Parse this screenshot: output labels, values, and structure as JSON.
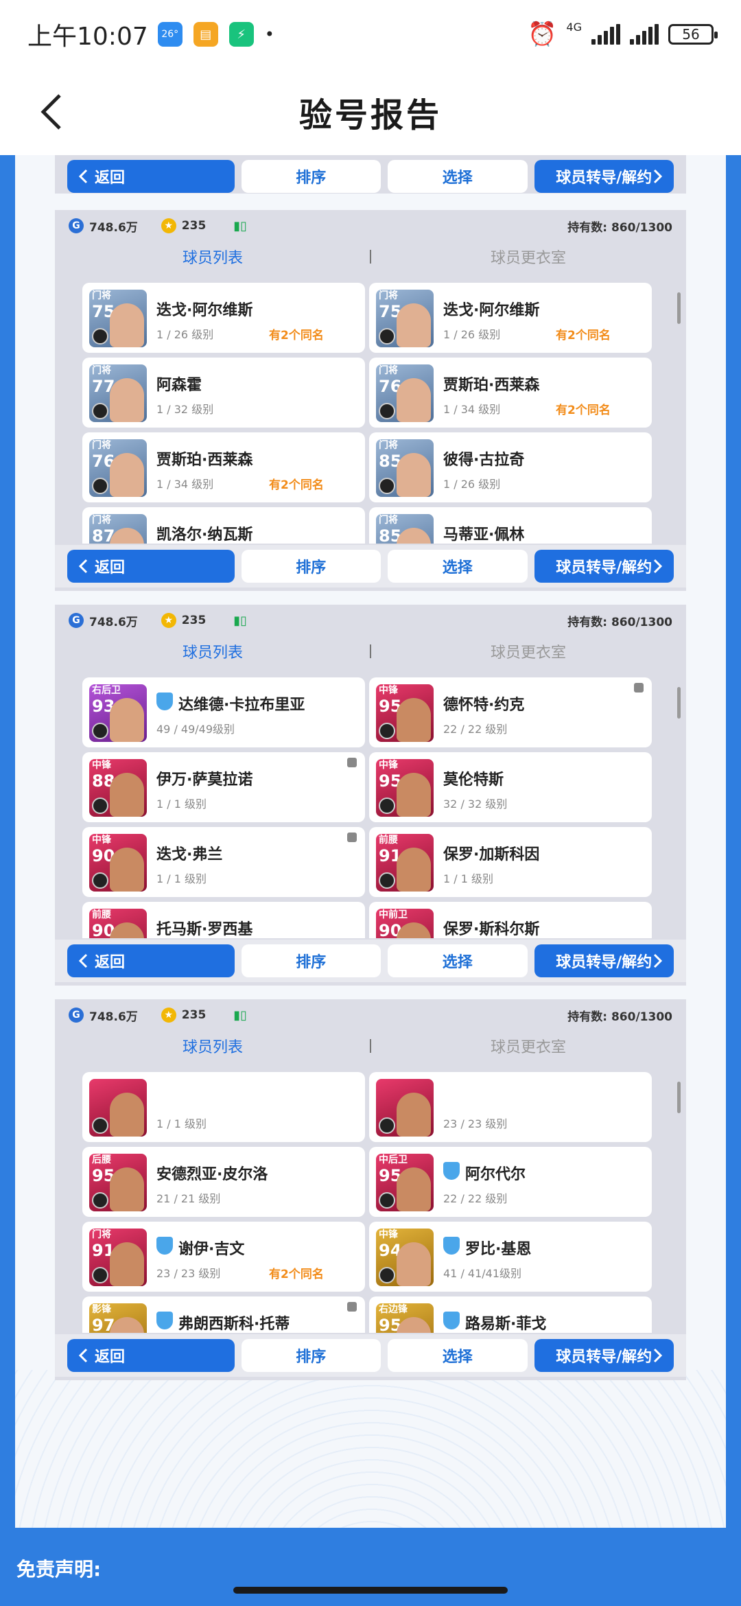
{
  "status_bar": {
    "time": "上午10:07",
    "weather_temp": "26°",
    "network": "4G",
    "battery": "56"
  },
  "header": {
    "title": "验号报告"
  },
  "buttons": {
    "back": "返回",
    "sort": "排序",
    "select": "选择",
    "transfer": "球员转导/解约"
  },
  "account": {
    "gp": "748.6万",
    "coins": "235",
    "owned": "持有数: 860/1300"
  },
  "tabs": {
    "list": "球员列表",
    "locker": "球员更衣室"
  },
  "panels": [
    {
      "cards": [
        {
          "pos": "门将",
          "rating": "75",
          "name": "迭戈·阿尔维斯",
          "level": "1 / 26 级别",
          "dup": "有2个同名",
          "style": "gk",
          "ver": false,
          "lock": false
        },
        {
          "pos": "门将",
          "rating": "75",
          "name": "迭戈·阿尔维斯",
          "level": "1 / 26 级别",
          "dup": "有2个同名",
          "style": "gk",
          "ver": false,
          "lock": false
        },
        {
          "pos": "门将",
          "rating": "77",
          "name": "阿森霍",
          "level": "1 / 32 级别",
          "dup": "",
          "style": "gk",
          "ver": false,
          "lock": false
        },
        {
          "pos": "门将",
          "rating": "76",
          "name": "贾斯珀·西莱森",
          "level": "1 / 34 级别",
          "dup": "有2个同名",
          "style": "gk",
          "ver": false,
          "lock": false
        },
        {
          "pos": "门将",
          "rating": "76",
          "name": "贾斯珀·西莱森",
          "level": "1 / 34 级别",
          "dup": "有2个同名",
          "style": "gk",
          "ver": false,
          "lock": false
        },
        {
          "pos": "门将",
          "rating": "85",
          "name": "彼得·古拉奇",
          "level": "1 / 26 级别",
          "dup": "",
          "style": "gk",
          "ver": false,
          "lock": false
        },
        {
          "pos": "门将",
          "rating": "87",
          "name": "凯洛尔·纳瓦斯",
          "level": "",
          "dup": "",
          "style": "gk",
          "ver": false,
          "lock": false
        },
        {
          "pos": "门将",
          "rating": "85",
          "name": "马蒂亚·佩林",
          "level": "",
          "dup": "",
          "style": "gk",
          "ver": false,
          "lock": false
        }
      ]
    },
    {
      "cards": [
        {
          "pos": "右后卫",
          "rating": "93",
          "name": "达维德·卡拉布里亚",
          "level": "49 / 49/49级别",
          "dup": "",
          "style": "pu",
          "ver": true,
          "lock": false
        },
        {
          "pos": "中锋",
          "rating": "95",
          "name": "德怀特·约克",
          "level": "22 / 22 级别",
          "dup": "",
          "style": "rd",
          "ver": false,
          "lock": true
        },
        {
          "pos": "中锋",
          "rating": "88",
          "name": "伊万·萨莫拉诺",
          "level": "1 / 1 级别",
          "dup": "",
          "style": "rd",
          "ver": false,
          "lock": true
        },
        {
          "pos": "中锋",
          "rating": "95",
          "name": "莫伦特斯",
          "level": "32 / 32 级别",
          "dup": "",
          "style": "rd",
          "ver": false,
          "lock": false
        },
        {
          "pos": "中锋",
          "rating": "90",
          "name": "迭戈·弗兰",
          "level": "1 / 1 级别",
          "dup": "",
          "style": "rd",
          "ver": false,
          "lock": true
        },
        {
          "pos": "前腰",
          "rating": "91",
          "name": "保罗·加斯科因",
          "level": "1 / 1 级别",
          "dup": "",
          "style": "rd",
          "ver": false,
          "lock": false
        },
        {
          "pos": "前腰",
          "rating": "90",
          "name": "托马斯·罗西基",
          "level": "",
          "dup": "",
          "style": "rd",
          "ver": false,
          "lock": false
        },
        {
          "pos": "中前卫",
          "rating": "90",
          "name": "保罗·斯科尔斯",
          "level": "",
          "dup": "",
          "style": "rd",
          "ver": false,
          "lock": false
        }
      ]
    },
    {
      "cards": [
        {
          "pos": "",
          "rating": "",
          "name": "",
          "level": "1 / 1 级别",
          "dup": "",
          "style": "rd",
          "ver": false,
          "lock": false
        },
        {
          "pos": "",
          "rating": "",
          "name": "",
          "level": "23 / 23 级别",
          "dup": "",
          "style": "rd",
          "ver": false,
          "lock": false
        },
        {
          "pos": "后腰",
          "rating": "95",
          "name": "安德烈亚·皮尔洛",
          "level": "21 / 21 级别",
          "dup": "",
          "style": "rd",
          "ver": false,
          "lock": false
        },
        {
          "pos": "中后卫",
          "rating": "95",
          "name": "阿尔代尔",
          "level": "22 / 22 级别",
          "dup": "",
          "style": "rd",
          "ver": true,
          "lock": false
        },
        {
          "pos": "门将",
          "rating": "91",
          "name": "谢伊·吉文",
          "level": "23 / 23 级别",
          "dup": "有2个同名",
          "style": "rd",
          "ver": true,
          "lock": false
        },
        {
          "pos": "中锋",
          "rating": "94",
          "name": "罗比·基恩",
          "level": "41 / 41/41级别",
          "dup": "",
          "style": "gd",
          "ver": true,
          "lock": false
        },
        {
          "pos": "影锋",
          "rating": "97",
          "name": "弗朗西斯科·托蒂",
          "level": "41 / 41/41级别",
          "dup": "",
          "style": "gd",
          "ver": true,
          "lock": true
        },
        {
          "pos": "右边锋",
          "rating": "95",
          "name": "路易斯·菲戈",
          "level": "35 / 35/35级别",
          "dup": "",
          "style": "gd",
          "ver": true,
          "lock": false
        }
      ]
    }
  ],
  "footer": {
    "disclaimer": "免责声明:"
  }
}
